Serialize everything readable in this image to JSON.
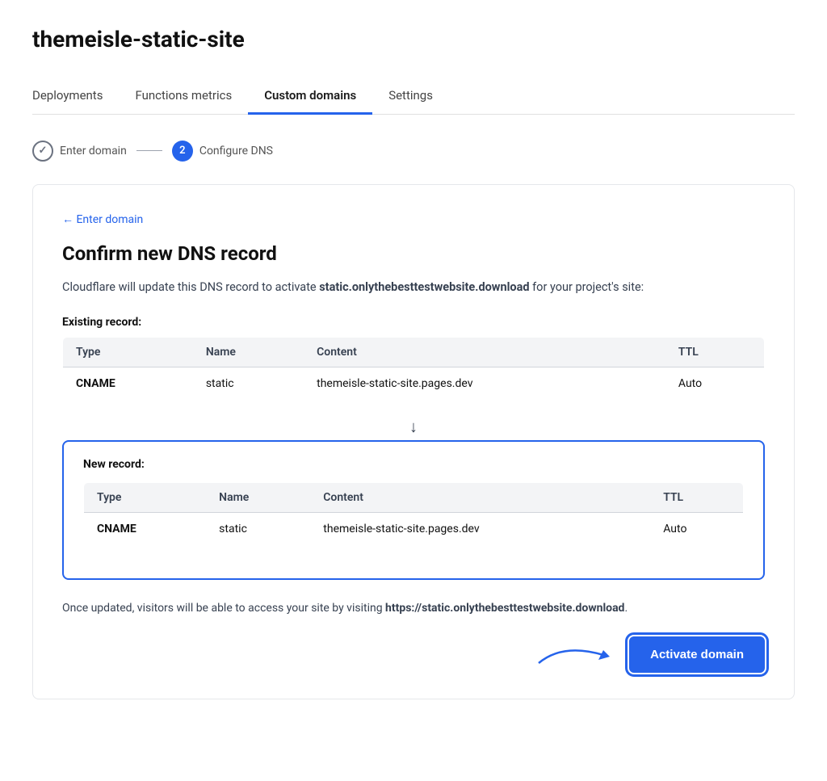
{
  "page": {
    "title": "themeisle-static-site"
  },
  "tabs": [
    {
      "id": "deployments",
      "label": "Deployments",
      "active": false
    },
    {
      "id": "functions-metrics",
      "label": "Functions metrics",
      "active": false
    },
    {
      "id": "custom-domains",
      "label": "Custom domains",
      "active": true
    },
    {
      "id": "settings",
      "label": "Settings",
      "active": false
    }
  ],
  "stepper": {
    "step1": {
      "label": "Enter domain",
      "state": "completed",
      "icon": "✓"
    },
    "step2": {
      "label": "Configure DNS",
      "state": "active",
      "number": "2"
    }
  },
  "card": {
    "back_link": "← Enter domain",
    "title": "Confirm new DNS record",
    "description_before": "Cloudflare will update this DNS record to activate ",
    "domain_bold": "static.onlythebesttestwebsite.download",
    "description_after": " for your project's site:",
    "existing_record_label": "Existing record:",
    "existing_table": {
      "headers": [
        "Type",
        "Name",
        "Content",
        "TTL"
      ],
      "rows": [
        {
          "type": "CNAME",
          "name": "static",
          "content": "themeisle-static-site.pages.dev",
          "ttl": "Auto"
        }
      ]
    },
    "new_record_label": "New record:",
    "new_table": {
      "headers": [
        "Type",
        "Name",
        "Content",
        "TTL"
      ],
      "rows": [
        {
          "type": "CNAME",
          "name": "static",
          "content": "themeisle-static-site.pages.dev",
          "ttl": "Auto"
        }
      ]
    },
    "footer_before": "Once updated, visitors will be able to access your site by visiting ",
    "footer_url": "https://static.onlythebesttestwebsite.download",
    "footer_after": ".",
    "activate_button": "Activate domain"
  },
  "colors": {
    "accent": "#2563eb",
    "text": "#111111",
    "muted": "#6b7280"
  }
}
